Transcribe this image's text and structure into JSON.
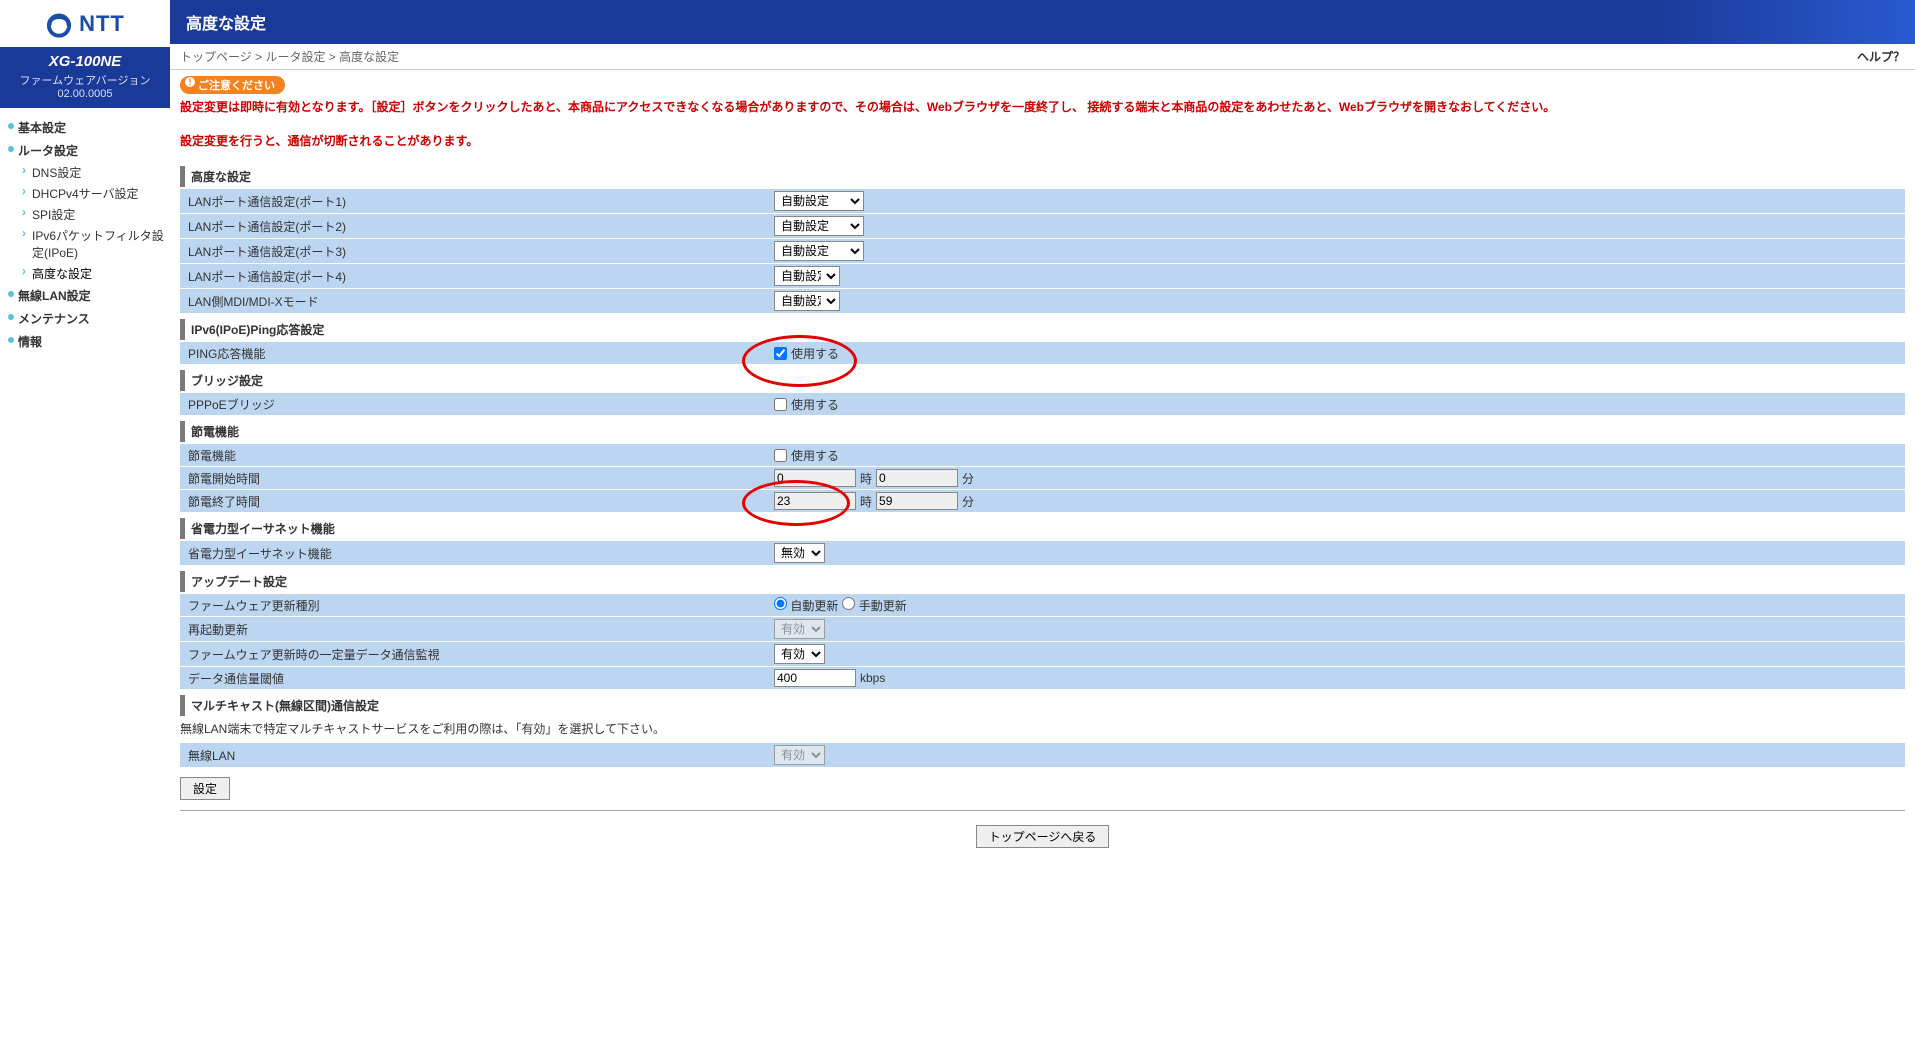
{
  "brand": "NTT",
  "model": "XG-100NE",
  "fw_label": "ファームウェアバージョン",
  "fw_ver": "02.00.0005",
  "nav": {
    "basic": "基本設定",
    "router": "ルータ設定",
    "sub": {
      "dns": "DNS設定",
      "dhcpv4": "DHCPv4サーバ設定",
      "spi": "SPI設定",
      "ipv6pf": "IPv6パケットフィルタ設定(IPoE)",
      "advanced": "高度な設定"
    },
    "wlan": "無線LAN設定",
    "maint": "メンテナンス",
    "info": "情報"
  },
  "title": "高度な設定",
  "crumbs": {
    "top": "トップページ",
    "router": "ルータ設定",
    "cur": "高度な設定"
  },
  "help": "ヘルプ？",
  "caution_badge": "ご注意ください",
  "warn1": "設定変更は即時に有効となります。［設定］ボタンをクリックしたあと、本商品にアクセスできなくなる場合がありますので、その場合は、Webブラウザを一度終了し、 接続する端末と本商品の設定をあわせたあと、Webブラウザを開きなおしてください。",
  "warn2": "設定変更を行うと、通信が切断されることがあります。",
  "sec": {
    "advanced": "高度な設定",
    "ipv6ping": "IPv6(IPoE)Ping応答設定",
    "bridge": "ブリッジ設定",
    "pwrs": "節電機能",
    "eee": "省電力型イーサネット機能",
    "update": "アップデート設定",
    "mcast": "マルチキャスト(無線区間)通信設定"
  },
  "rows": {
    "lan1": "LANポート通信設定(ポート1)",
    "lan2": "LANポート通信設定(ポート2)",
    "lan3": "LANポート通信設定(ポート3)",
    "lan4": "LANポート通信設定(ポート4)",
    "mdi": "LAN側MDI/MDI-Xモード",
    "ping": "PING応答機能",
    "pppoe": "PPPoEブリッジ",
    "pwrs_func": "節電機能",
    "pwrs_start": "節電開始時間",
    "pwrs_end": "節電終了時間",
    "eee_func": "省電力型イーサネット機能",
    "fw_type": "ファームウェア更新種別",
    "reboot_upd": "再起動更新",
    "fw_mon": "ファームウェア更新時の一定量データ通信監視",
    "threshold": "データ通信量閾値",
    "wlan": "無線LAN"
  },
  "opt": {
    "auto": "自動設定",
    "disabled": "無効",
    "enabled": "有効",
    "use": "使用する",
    "auto_upd": "自動更新",
    "manual_upd": "手動更新"
  },
  "vals": {
    "start_h": "0",
    "start_m": "0",
    "end_h": "23",
    "end_m": "59",
    "threshold": "400"
  },
  "units": {
    "h": "時",
    "m": "分",
    "kbps": "kbps"
  },
  "mcast_note": "無線LAN端末で特定マルチキャストサービスをご利用の際は、「有効」を選択して下さい。",
  "btn_set": "設定",
  "btn_back": "トップページへ戻る"
}
